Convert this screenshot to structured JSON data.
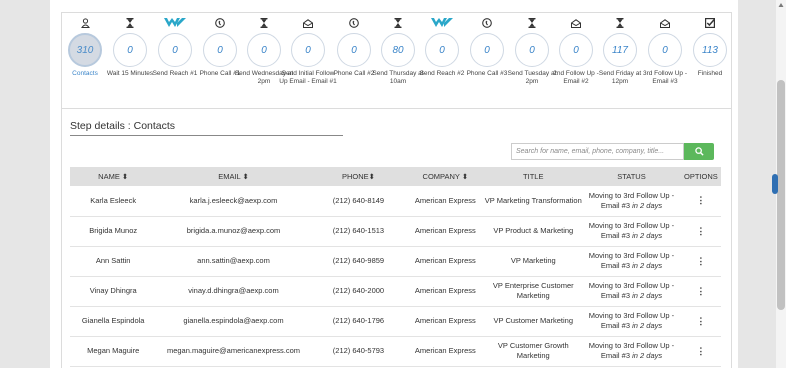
{
  "steps": [
    {
      "label": "Contacts",
      "count": "310",
      "icon": "person-icon",
      "active": true
    },
    {
      "label": "Wait 15 Minutes",
      "count": "0",
      "icon": "hourglass-icon"
    },
    {
      "label": "Send Reach #1",
      "count": "0",
      "icon": "reach-logo-icon"
    },
    {
      "label": "Phone Call #1",
      "count": "0",
      "icon": "phone-icon"
    },
    {
      "label": "Send Wednesday at 2pm",
      "count": "0",
      "icon": "hourglass-icon"
    },
    {
      "label": "Send Initial Follow Up Email - Email #1",
      "count": "0",
      "icon": "envelope-icon"
    },
    {
      "label": "Phone Call #2",
      "count": "0",
      "icon": "phone-icon"
    },
    {
      "label": "Send Thursday at 10am",
      "count": "80",
      "icon": "hourglass-icon"
    },
    {
      "label": "Send Reach #2",
      "count": "0",
      "icon": "reach-logo-icon"
    },
    {
      "label": "Phone Call #3",
      "count": "0",
      "icon": "phone-icon"
    },
    {
      "label": "Send Tuesday at 2pm",
      "count": "0",
      "icon": "hourglass-icon"
    },
    {
      "label": "2nd Follow Up - Email #2",
      "count": "0",
      "icon": "envelope-icon"
    },
    {
      "label": "Send Friday at 12pm",
      "count": "117",
      "icon": "hourglass-icon"
    },
    {
      "label": "3rd Follow Up - Email #3",
      "count": "0",
      "icon": "envelope-icon"
    },
    {
      "label": "Finished",
      "count": "113",
      "icon": "checkbox-icon"
    }
  ],
  "step_details_title": "Step details : Contacts",
  "search": {
    "placeholder": "Search for name, email, phone, company, title..."
  },
  "table": {
    "headers": [
      "NAME",
      "EMAIL",
      "PHONE",
      "COMPANY",
      "TITLE",
      "STATUS",
      "OPTIONS"
    ],
    "rows": [
      {
        "name": "Karla Esleeck",
        "email": "karla.j.esleeck@aexp.com",
        "phone": "(212) 640-8149",
        "company": "American Express",
        "title": "VP Marketing Transformation",
        "status": "Moving to 3rd Follow Up - Email #3",
        "status_when": "in 2 days"
      },
      {
        "name": "Brigida Munoz",
        "email": "brigida.a.munoz@aexp.com",
        "phone": "(212) 640-1513",
        "company": "American Express",
        "title": "VP Product & Marketing",
        "status": "Moving to 3rd Follow Up - Email #3",
        "status_when": "in 2 days"
      },
      {
        "name": "Ann Sattin",
        "email": "ann.sattin@aexp.com",
        "phone": "(212) 640-9859",
        "company": "American Express",
        "title": "VP Marketing",
        "status": "Moving to 3rd Follow Up - Email #3",
        "status_when": "in 2 days"
      },
      {
        "name": "Vinay Dhingra",
        "email": "vinay.d.dhingra@aexp.com",
        "phone": "(212) 640-2000",
        "company": "American Express",
        "title": "VP Enterprise Customer Marketing",
        "status": "Moving to 3rd Follow Up - Email #3",
        "status_when": "in 2 days"
      },
      {
        "name": "Gianella Espindola",
        "email": "gianella.espindola@aexp.com",
        "phone": "(212) 640-1796",
        "company": "American Express",
        "title": "VP Customer Marketing",
        "status": "Moving to 3rd Follow Up - Email #3",
        "status_when": "in 2 days"
      },
      {
        "name": "Megan Maguire",
        "email": "megan.maguire@americanexpress.com",
        "phone": "(212) 640-5793",
        "company": "American Express",
        "title": "VP Customer Growth Marketing",
        "status": "Moving to 3rd Follow Up - Email #3",
        "status_when": "in 2 days"
      }
    ]
  },
  "colors": {
    "accent": "#3b85c9",
    "search_button": "#5cb85c",
    "reach_logo": "#2aa7c9"
  }
}
